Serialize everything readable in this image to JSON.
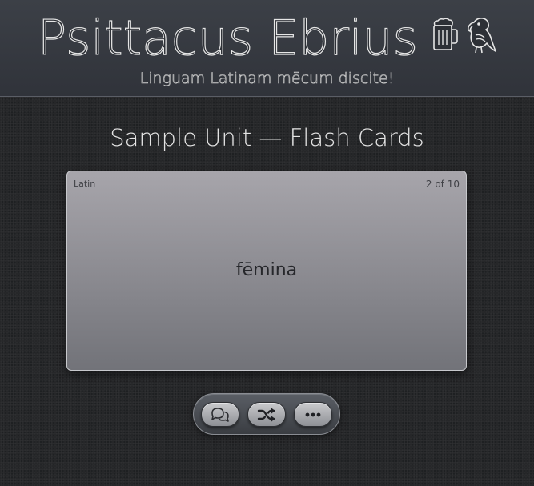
{
  "header": {
    "title": "Psittacus Ebrius",
    "tagline": "Linguam Latinam mēcum discite!",
    "icons": [
      "beer-mug-icon",
      "parrot-icon"
    ]
  },
  "page": {
    "title": "Sample Unit — Flash Cards"
  },
  "card": {
    "language": "Latin",
    "counter": "2 of 10",
    "word": "fēmina"
  },
  "toolbar": {
    "buttons": [
      {
        "icon": "chat-bubbles-icon"
      },
      {
        "icon": "shuffle-icon"
      },
      {
        "icon": "more-options-icon"
      }
    ]
  }
}
